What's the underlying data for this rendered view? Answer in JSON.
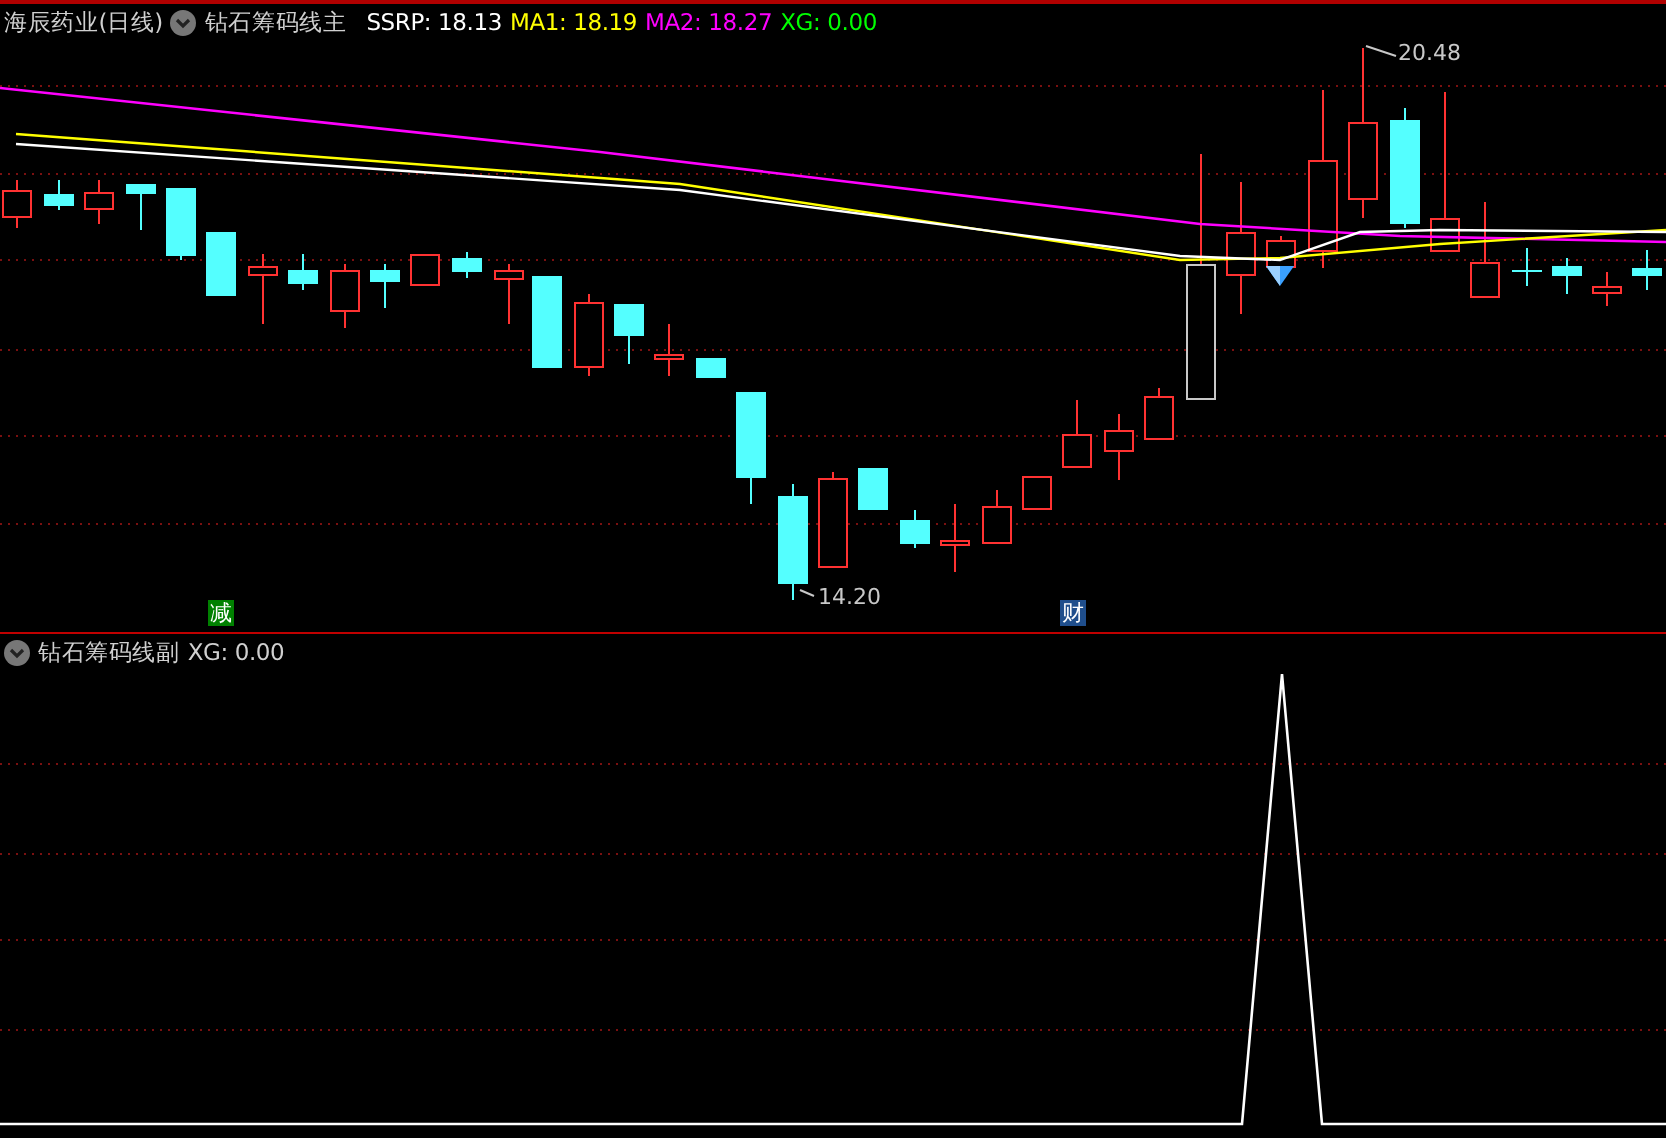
{
  "main_panel": {
    "stock": "海辰药业",
    "period": "(日线)",
    "indicator": "钻石筹码线主",
    "legend": [
      {
        "label": "SSRP: 18.13",
        "color": "#ffffff"
      },
      {
        "label": "MA1: 18.19",
        "color": "#ffff00"
      },
      {
        "label": "MA2: 18.27",
        "color": "#ff00ff"
      },
      {
        "label": "XG: 0.00",
        "color": "#00ff00"
      }
    ],
    "high_label": "20.48",
    "low_label": "14.20",
    "signals": [
      {
        "text": "减",
        "color": "#008000"
      },
      {
        "text": "财",
        "color": "#1f4e8c"
      }
    ]
  },
  "sub_panel": {
    "indicator": "钻石筹码线副",
    "reading": "XG: 0.00"
  }
}
